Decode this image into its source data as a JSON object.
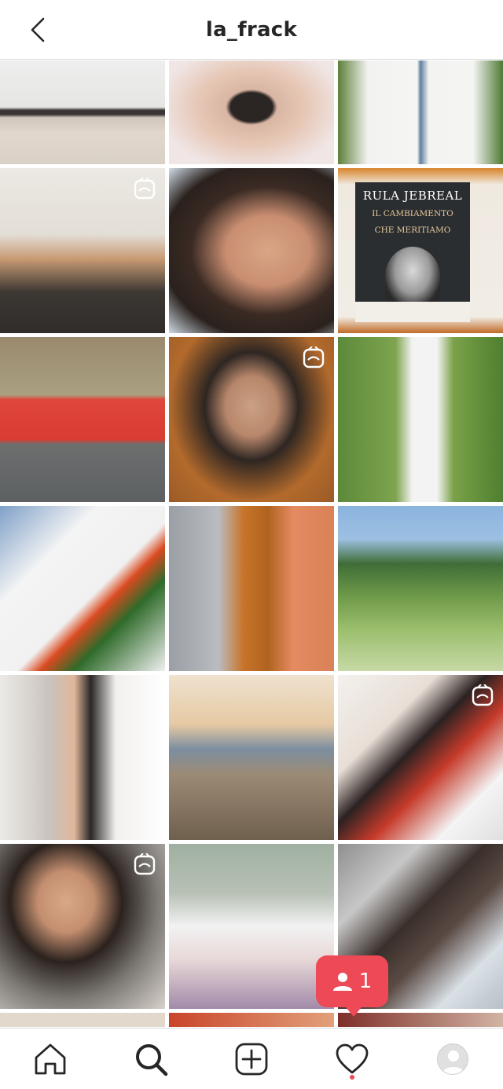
{
  "header": {
    "title": "la_frack"
  },
  "book": {
    "author": "RULA JEBREAL",
    "title_line1": "IL CAMBIAMENTO",
    "title_line2": "CHE MERITIAMO"
  },
  "notification": {
    "count": "1"
  },
  "grid": {
    "tiles": [
      {
        "row": 0,
        "reel": false
      },
      {
        "row": 0,
        "reel": false
      },
      {
        "row": 0,
        "reel": false
      },
      {
        "row": 1,
        "reel": true
      },
      {
        "row": 1,
        "reel": false
      },
      {
        "row": 1,
        "reel": false
      },
      {
        "row": 2,
        "reel": false
      },
      {
        "row": 2,
        "reel": true
      },
      {
        "row": 2,
        "reel": false
      },
      {
        "row": 3,
        "reel": false
      },
      {
        "row": 3,
        "reel": false
      },
      {
        "row": 3,
        "reel": false
      },
      {
        "row": 4,
        "reel": false
      },
      {
        "row": 4,
        "reel": false
      },
      {
        "row": 4,
        "reel": true
      },
      {
        "row": 5,
        "reel": true
      },
      {
        "row": 5,
        "reel": false
      },
      {
        "row": 5,
        "reel": false
      }
    ]
  },
  "tabs": [
    {
      "name": "home-icon",
      "active": false
    },
    {
      "name": "search-icon",
      "active": true
    },
    {
      "name": "add-post-icon",
      "active": false
    },
    {
      "name": "heart-icon",
      "active": false,
      "has_dot": true
    },
    {
      "name": "profile-avatar",
      "active": false
    }
  ],
  "colors": {
    "accent": "#ed4956",
    "text": "#262626",
    "border": "#dbdbdb"
  }
}
